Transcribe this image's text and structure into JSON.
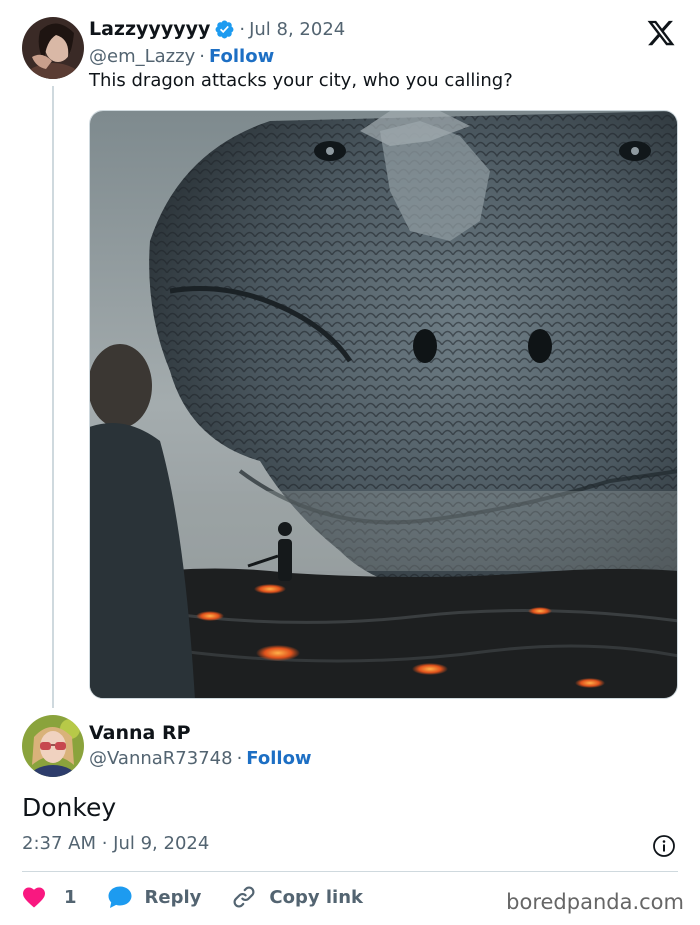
{
  "tweet": {
    "author_name": "Lazzyyyyyy",
    "date": "Jul 8, 2024",
    "separator": "·",
    "handle": "@em_Lazzy",
    "follow_label": "Follow",
    "text": "This dragon attacks your city, who you calling?"
  },
  "reply": {
    "author_name": "Vanna RP",
    "handle": "@VannaR73748",
    "separator": "·",
    "follow_label": "Follow",
    "text": "Donkey",
    "timestamp": "2:37 AM · Jul 9, 2024"
  },
  "actions": {
    "like_count": "1",
    "reply_label": "Reply",
    "copy_link_label": "Copy link"
  },
  "watermark": "boredpanda.com",
  "colors": {
    "like": "#f91880",
    "reply_icon": "#1d9bf0",
    "follow": "#1d6fc4",
    "verified": "#1d9bf0",
    "secondary_text": "#536471"
  },
  "icons": [
    "verified-badge-icon",
    "x-logo-icon",
    "info-icon",
    "heart-icon",
    "reply-bubble-icon",
    "link-icon"
  ]
}
